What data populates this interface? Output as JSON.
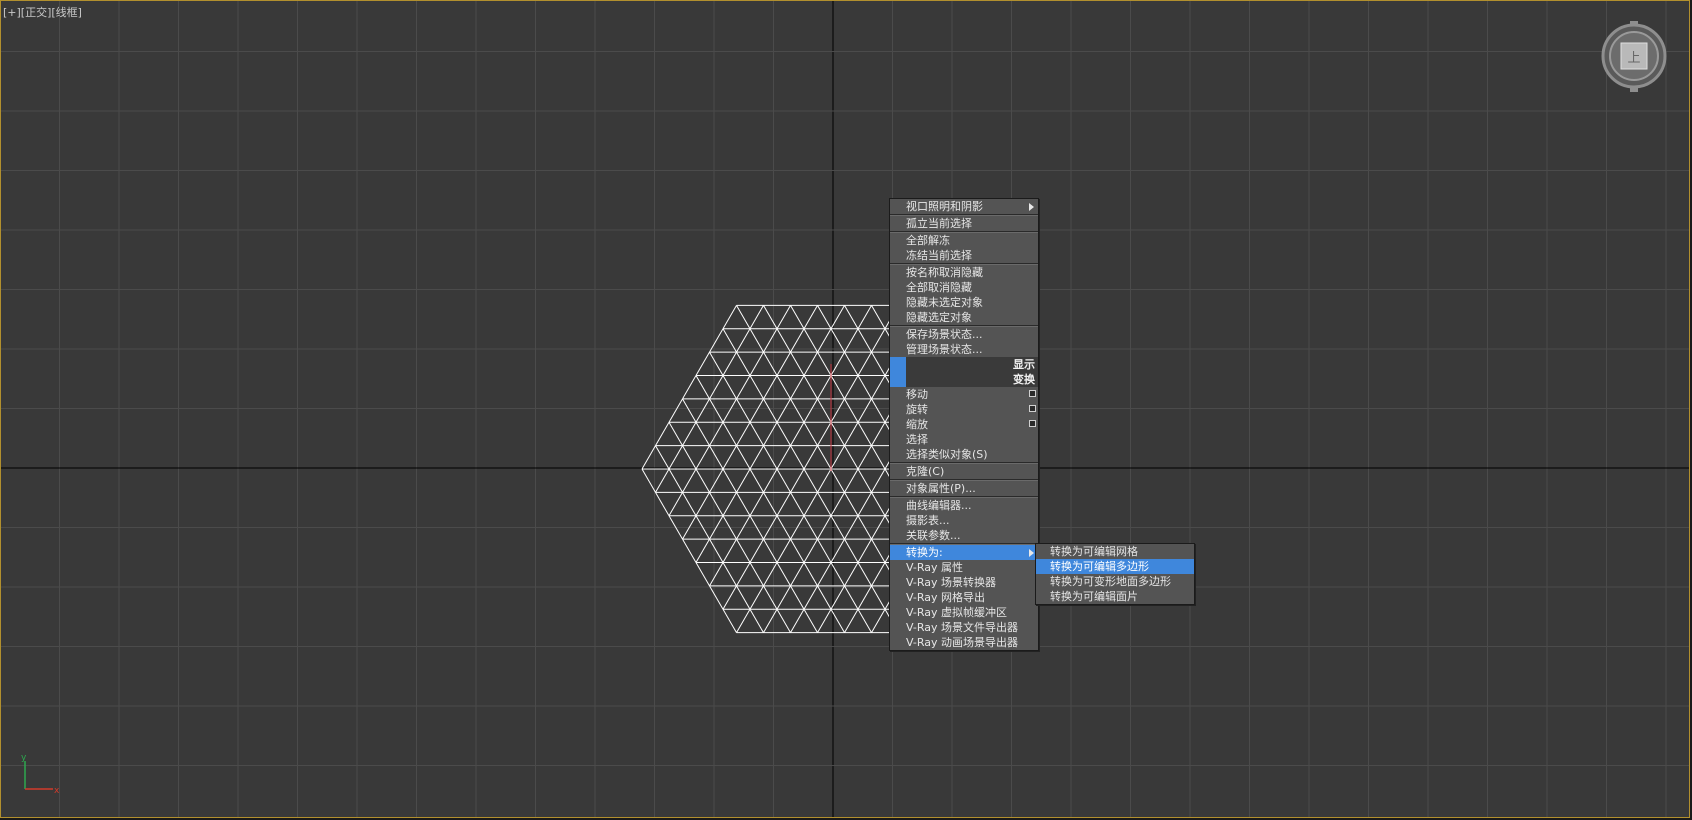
{
  "viewport": {
    "label": "[+][正交][线框]",
    "viewcube_face": "上",
    "axis": {
      "y": "y",
      "x": "x"
    },
    "colors": {
      "background": "#393939",
      "grid": "#4b4b4b",
      "axis": "#000000",
      "mesh": "#ffffff",
      "active_border": "#b2902e"
    }
  },
  "quad_menu": {
    "display_section": {
      "header": "显示",
      "items": [
        {
          "label": "视口照明和阴影",
          "submenu": true
        },
        {
          "label": "孤立当前选择"
        },
        {
          "label": "全部解冻"
        },
        {
          "label": "冻结当前选择"
        },
        {
          "label": "按名称取消隐藏"
        },
        {
          "label": "全部取消隐藏"
        },
        {
          "label": "隐藏未选定对象"
        },
        {
          "label": "隐藏选定对象"
        },
        {
          "label": "保存场景状态..."
        },
        {
          "label": "管理场景状态..."
        }
      ]
    },
    "transform_section": {
      "header": "变换",
      "items": [
        {
          "label": "移动",
          "options": true
        },
        {
          "label": "旋转",
          "options": true
        },
        {
          "label": "缩放",
          "options": true
        },
        {
          "label": "选择"
        },
        {
          "label": "选择类似对象(S)"
        },
        {
          "label": "克隆(C)"
        },
        {
          "label": "对象属性(P)..."
        },
        {
          "label": "曲线编辑器..."
        },
        {
          "label": "摄影表..."
        },
        {
          "label": "关联参数..."
        },
        {
          "label": "转换为:",
          "submenu": true,
          "highlighted": true
        },
        {
          "label": "V-Ray 属性"
        },
        {
          "label": "V-Ray 场景转换器"
        },
        {
          "label": "V-Ray 网格导出"
        },
        {
          "label": "V-Ray 虚拟帧缓冲区"
        },
        {
          "label": "V-Ray 场景文件导出器"
        },
        {
          "label": "V-Ray 动画场景导出器"
        }
      ]
    }
  },
  "convert_submenu": {
    "items": [
      {
        "label": "转换为可编辑网格"
      },
      {
        "label": "转换为可编辑多边形",
        "highlighted": true
      },
      {
        "label": "转换为可变形地面多边形"
      },
      {
        "label": "转换为可编辑面片"
      }
    ]
  },
  "highlight_color": "#3f87dc"
}
